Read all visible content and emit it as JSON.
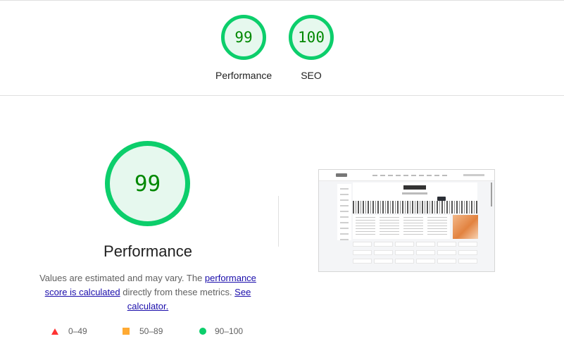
{
  "summary": {
    "gauges": [
      {
        "label": "Performance",
        "score": "99"
      },
      {
        "label": "SEO",
        "score": "100"
      }
    ]
  },
  "performance": {
    "score": "99",
    "title": "Performance",
    "note_prefix": "Values are estimated and may vary. The ",
    "link_score": "performance score is calculated",
    "note_middle": " directly from these metrics. ",
    "link_calc": "See calculator."
  },
  "legend": {
    "fail": "0–49",
    "average": "50–89",
    "pass": "90–100"
  },
  "colors": {
    "pass": "#0cce6b",
    "average": "#ffaa33",
    "fail": "#ff3333",
    "pass_text": "#008800",
    "link": "#1a0dab"
  },
  "icons": {
    "fail": "triangle",
    "average": "square",
    "pass": "circle"
  }
}
